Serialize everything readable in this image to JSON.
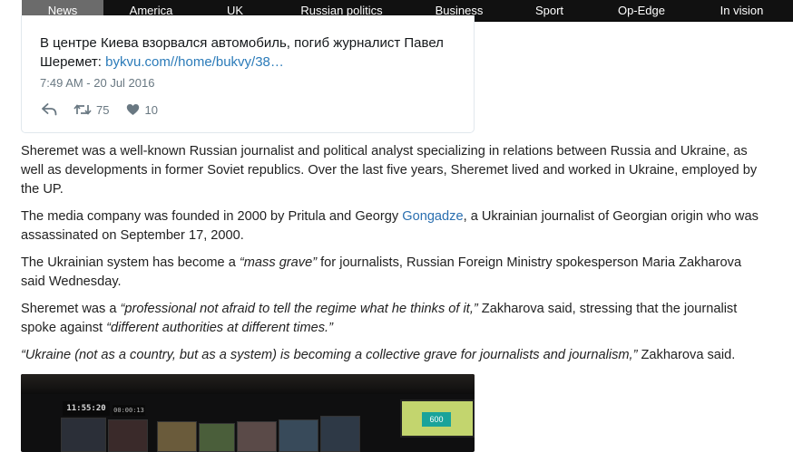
{
  "nav": {
    "items": [
      {
        "label": "News",
        "active": true
      },
      {
        "label": "America",
        "active": false
      },
      {
        "label": "UK",
        "active": false
      },
      {
        "label": "Russian politics",
        "active": false
      },
      {
        "label": "Business",
        "active": false
      },
      {
        "label": "Sport",
        "active": false
      },
      {
        "label": "Op-Edge",
        "active": false
      },
      {
        "label": "In vision",
        "active": false
      }
    ]
  },
  "tweet": {
    "text": "В центре Киева взорвался автомобиль, погиб журналист Павел Шеремет: ",
    "link": "bykvu.com//home/bukvy/38…",
    "timestamp": "7:49 AM - 20 Jul 2016",
    "retweets": "75",
    "likes": "10"
  },
  "article": {
    "p1": "Sheremet was a well-known Russian journalist and political analyst specializing in relations between Russia and Ukraine, as well as developments in former Soviet republics. Over the last five years, Sheremet lived and worked in Ukraine, employed by the UP.",
    "p2_a": "The media company was founded in 2000 by Pritula and Georgy ",
    "p2_link": "Gongadze",
    "p2_b": ", a Ukrainian journalist of Georgian origin who was assassinated on September 17, 2000.",
    "p3_a": "The Ukrainian system has become a ",
    "p3_quote": "“mass grave”",
    "p3_b": " for journalists, Russian Foreign Ministry spokesperson Maria Zakharova said Wednesday.",
    "p4_a": "Sheremet was a ",
    "p4_quote1": "“professional not afraid to tell the regime what he thinks of it,”",
    "p4_b": " Zakharova said, stressing that the journalist spoke against ",
    "p4_quote2": "“different authorities at different times.”",
    "p5_quote": "“Ukraine (not as a country, but as a system) is becoming a collective grave for journalists and journalism,”",
    "p5_b": " Zakharova said."
  },
  "photo": {
    "clock": "11:55:20",
    "timer": "00:00:13",
    "screen_number": "600"
  },
  "colors": {
    "nav_bg": "#111111",
    "nav_active": "#6b6b6b",
    "link": "#2a6fb0",
    "tweet_link": "#2b7bb9",
    "meta_gray": "#697882"
  }
}
